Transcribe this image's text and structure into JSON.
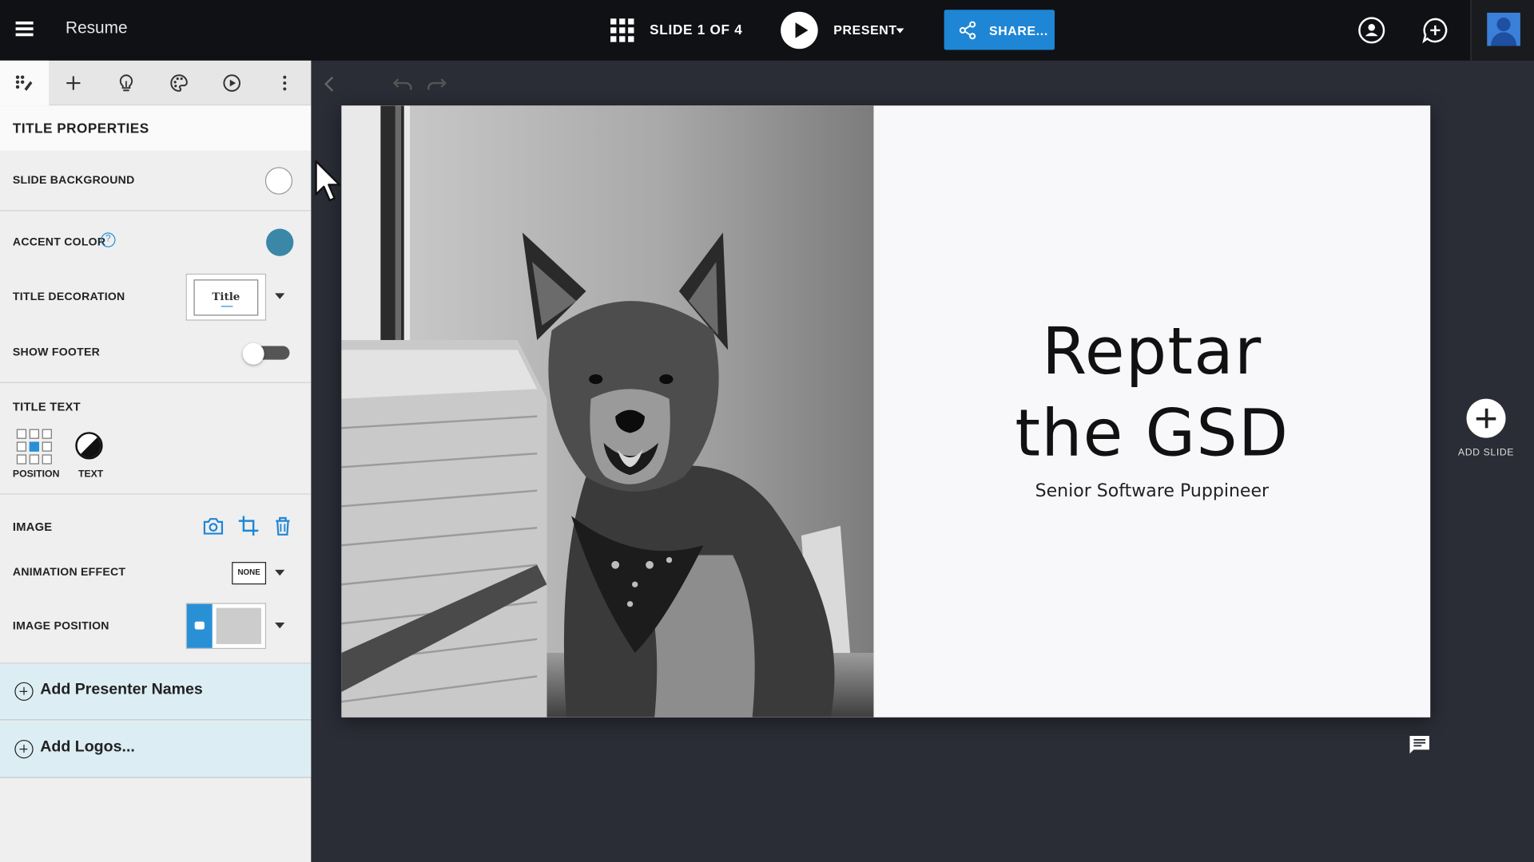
{
  "topbar": {
    "doc_title": "Resume",
    "slide_counter": "SLIDE 1 OF 4",
    "present_label": "PRESENT",
    "share_label": "SHARE..."
  },
  "panel": {
    "tabs": [
      "design-icon",
      "add-icon",
      "lightbulb-icon",
      "palette-icon",
      "play-circle-icon",
      "more-icon"
    ],
    "header": "TITLE PROPERTIES",
    "slide_background": "SLIDE BACKGROUND",
    "slide_background_color": "#ffffff",
    "accent_color": "ACCENT COLOR",
    "accent_color_value": "#3a87a8",
    "help_glyph": "?",
    "title_decoration": "TITLE DECORATION",
    "title_decoration_preview": "Title",
    "show_footer": "SHOW FOOTER",
    "show_footer_on": false,
    "title_text": "TITLE TEXT",
    "position_label": "POSITION",
    "text_label": "TEXT",
    "image": "IMAGE",
    "animation_effect": "ANIMATION EFFECT",
    "animation_value": "NONE",
    "image_position": "IMAGE POSITION",
    "add_presenter": "Add Presenter Names",
    "add_logos": "Add Logos..."
  },
  "slide": {
    "title_line1": "Reptar",
    "title_line2": "the GSD",
    "subtitle": "Senior Software Puppineer"
  },
  "canvas": {
    "add_slide": "ADD SLIDE"
  },
  "colors": {
    "topbar_bg": "#101114",
    "share_blue": "#1f86d6",
    "canvas_bg": "#2a2d36",
    "panel_bg": "#efefef",
    "add_row_bg": "#dceef4"
  }
}
